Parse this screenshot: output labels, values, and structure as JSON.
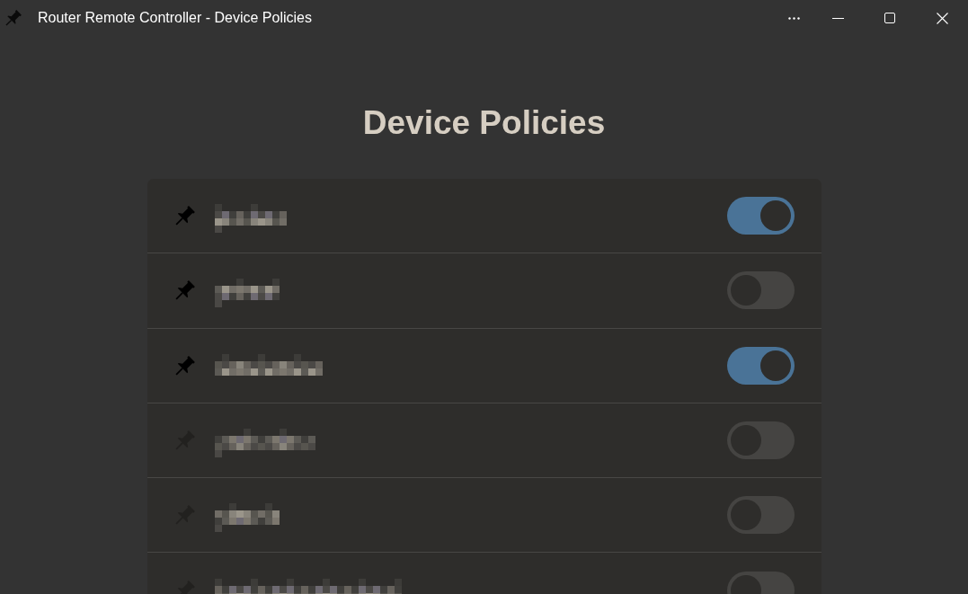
{
  "window": {
    "title": "Router Remote Controller - Device Policies"
  },
  "heading": "Device Policies",
  "rows": [
    {
      "redacted": true,
      "pinned": true,
      "on": true
    },
    {
      "redacted": true,
      "pinned": true,
      "on": false
    },
    {
      "redacted": true,
      "pinned": true,
      "on": true
    },
    {
      "redacted": true,
      "pinned": false,
      "on": false
    },
    {
      "redacted": true,
      "pinned": false,
      "on": false
    },
    {
      "redacted": true,
      "pinned": false,
      "on": false
    }
  ]
}
